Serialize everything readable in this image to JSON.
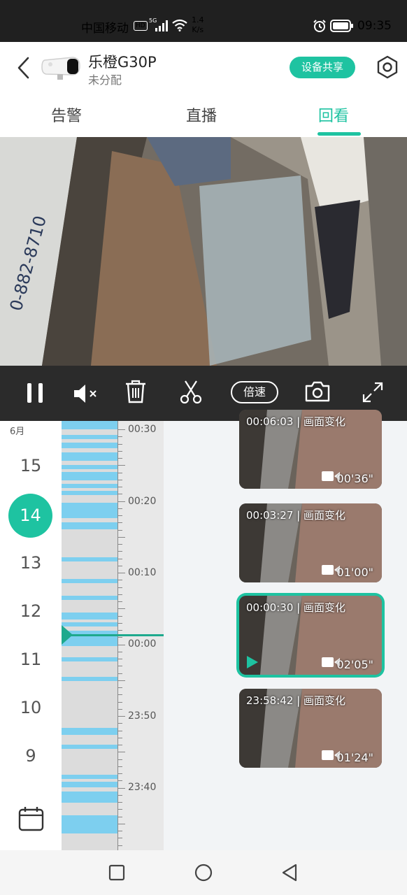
{
  "status_bar": {
    "carrier": "中国移动",
    "hd": "HD",
    "network": "5G",
    "speed_value": "1.4",
    "speed_unit": "K/s",
    "time": "09:35"
  },
  "header": {
    "device_name": "乐橙G30P",
    "device_group": "未分配",
    "share_button": "设备共享",
    "icons": [
      "back-icon",
      "camera-icon",
      "settings-icon"
    ]
  },
  "tabs": [
    {
      "label": "告警",
      "active": false
    },
    {
      "label": "直播",
      "active": false
    },
    {
      "label": "回看",
      "active": true
    }
  ],
  "controls": {
    "speed_label": "倍速",
    "icons": [
      "pause-icon",
      "mute-icon",
      "delete-icon",
      "scissors-icon",
      "snapshot-icon",
      "fullscreen-icon"
    ]
  },
  "calendar": {
    "month": "6月",
    "dates": [
      "15",
      "14",
      "13",
      "12",
      "11",
      "10",
      "9"
    ],
    "selected": "14"
  },
  "timeline": {
    "labels": [
      "00:30",
      "00:20",
      "00:10",
      "00:00",
      "23:50",
      "23:40"
    ]
  },
  "clips": [
    {
      "title": "00:06:03 | 画面变化",
      "duration": "00'36\"",
      "selected": false
    },
    {
      "title": "00:03:27 | 画面变化",
      "duration": "01'00\"",
      "selected": false
    },
    {
      "title": "00:00:30 | 画面变化",
      "duration": "02'05\"",
      "selected": true
    },
    {
      "title": "23:58:42 | 画面变化",
      "duration": "01'24\"",
      "selected": false
    }
  ],
  "colors": {
    "accent": "#1ec3a1",
    "timeline_segment": "#7dcfef",
    "control_bar": "#2b2b2b"
  }
}
